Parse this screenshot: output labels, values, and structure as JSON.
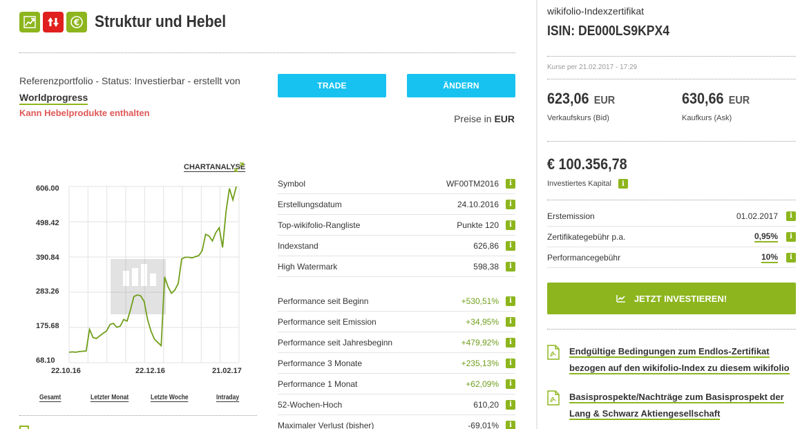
{
  "header": {
    "title": "Struktur und Hebel",
    "icons": [
      "trend-up-icon",
      "up-down-arrows-icon",
      "euro-icon"
    ],
    "colors": {
      "green": "#8db51d",
      "red": "#e0201e"
    }
  },
  "portfolio": {
    "ref_text": "Referenzportfolio - Status: Investierbar - erstellt von",
    "author": "Worldprogress",
    "hebel_note": "Kann Hebelprodukte enthalten"
  },
  "buttons": {
    "trade": "TRADE",
    "change": "ÄNDERN"
  },
  "prices_in": {
    "label": "Preise in",
    "currency": "EUR"
  },
  "chart_link": "CHARTANALYSE",
  "chart_data": {
    "type": "line",
    "y_ticks": [
      "606.00",
      "498.42",
      "390.84",
      "283.26",
      "175.68",
      "68.10"
    ],
    "ylim": [
      68.1,
      606.0
    ],
    "x_ticks": [
      "22.10.16",
      "22.12.16",
      "21.02.17"
    ],
    "series": [
      {
        "values": [
          100,
          101,
          100,
          102,
          103,
          104,
          170,
          145,
          142,
          150,
          158,
          165,
          185,
          188,
          176,
          180,
          200,
          195,
          230,
          270,
          275,
          272,
          255,
          200,
          165,
          140,
          130,
          120,
          330,
          300,
          280,
          290,
          310,
          385,
          390,
          390,
          388,
          392,
          395,
          410,
          460,
          455,
          440,
          465,
          480,
          420,
          530,
          600,
          565,
          606
        ]
      }
    ],
    "ranges": [
      "Gesamt",
      "Letzter Monat",
      "Letzte Woche",
      "Intraday"
    ]
  },
  "table": [
    {
      "label": "Symbol",
      "value": "WF00TM2016",
      "pos": false
    },
    {
      "label": "Erstellungsdatum",
      "value": "24.10.2016",
      "pos": false
    },
    {
      "label": "Top-wikifolio-Rangliste",
      "value": "Punkte 120",
      "pos": false
    },
    {
      "label": "Indexstand",
      "value": "626,86",
      "pos": false
    },
    {
      "label": "High Watermark",
      "value": "598,38",
      "pos": false
    }
  ],
  "perf_table": [
    {
      "label": "Performance seit Beginn",
      "value": "+530,51%",
      "pos": true
    },
    {
      "label": "Performance seit Emission",
      "value": "+34,95%",
      "pos": true
    },
    {
      "label": "Performance seit Jahresbeginn",
      "value": "+479,92%",
      "pos": true
    },
    {
      "label": "Performance 3 Monate",
      "value": "+235,13%",
      "pos": true
    },
    {
      "label": "Performance 1 Monat",
      "value": "+62,09%",
      "pos": true
    },
    {
      "label": "52-Wochen-Hoch",
      "value": "610,20",
      "pos": false
    },
    {
      "label": "Maximaler Verlust (bisher)",
      "value": "-69,01%",
      "pos": false
    }
  ],
  "right": {
    "subtitle": "wikifolio-Indexzertifikat",
    "isin": "ISIN: DE000LS9KPX4",
    "kurse": "Kurse per 21.02.2017 - 17:29",
    "bid": "623,06",
    "ask": "630,66",
    "currency": "EUR",
    "bid_label": "Verkaufskurs (Bid)",
    "ask_label": "Kaufkurs (Ask)",
    "invested": "€ 100.356,78",
    "invested_label": "Investiertes Kapital",
    "rows": [
      {
        "label": "Erstemission",
        "value": "01.02.2017",
        "ul": false
      },
      {
        "label": "Zertifikategebühr p.a.",
        "value": "0,95%",
        "ul": true
      },
      {
        "label": "Performancegebühr",
        "value": "10%",
        "ul": true
      }
    ],
    "invest_button": "JETZT INVESTIEREN!",
    "docs": [
      "Endgültige Bedingungen zum Endlos-Zertifikat bezogen auf den wikifolio-Index zu diesem wikifolio",
      "Basisprospekte/Nachträge zum Basisprospekt der Lang & Schwarz Aktiengesellschaft"
    ]
  },
  "info_badge": "i"
}
